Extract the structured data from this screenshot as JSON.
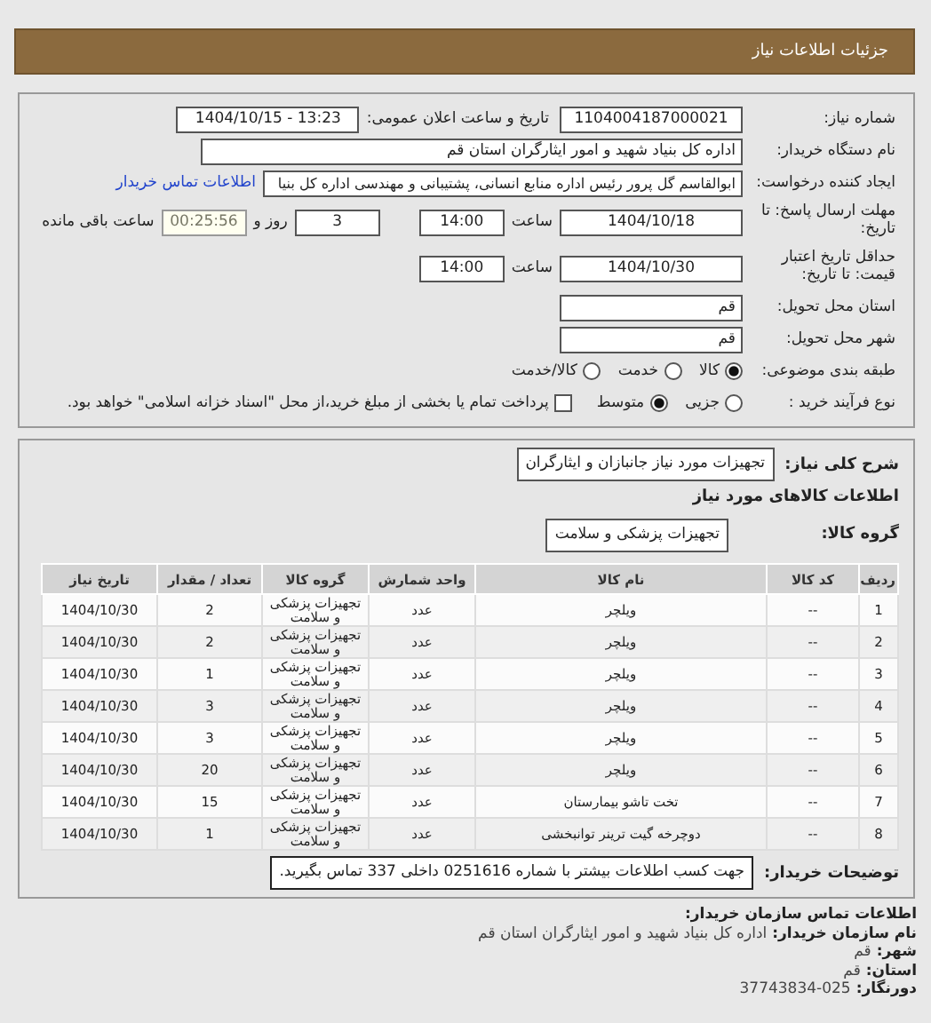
{
  "header": {
    "title": "جزئیات اطلاعات نیاز"
  },
  "need_number": {
    "label": "شماره نیاز:",
    "value": "1104004187000021"
  },
  "announce": {
    "label": "تاریخ و ساعت اعلان عمومی:",
    "value": "1404/10/15 - 13:23"
  },
  "buyer": {
    "label": "نام دستگاه خریدار:",
    "value": "اداره کل بنیاد شهید و امور ایثارگران استان قم"
  },
  "requester": {
    "label": "ایجاد کننده درخواست:",
    "value": "ابوالقاسم گل پرور رئیس اداره منابع انسانی، پشتیبانی و مهندسی اداره کل بنیا",
    "link": "اطلاعات تماس خریدار"
  },
  "deadline": {
    "label": "مهلت ارسال پاسخ: تا تاریخ:",
    "date": "1404/10/18",
    "time_label": "ساعت",
    "time": "14:00",
    "days": "3",
    "days_label": "روز و",
    "remaining": "00:25:56",
    "remaining_label": "ساعت باقی مانده"
  },
  "validity": {
    "label": "حداقل تاریخ اعتبار قیمت: تا تاریخ:",
    "date": "1404/10/30",
    "time_label": "ساعت",
    "time": "14:00"
  },
  "province": {
    "label": "استان محل تحویل:",
    "value": "قم"
  },
  "city": {
    "label": "شهر محل تحویل:",
    "value": "قم"
  },
  "category": {
    "label": "طبقه بندی موضوعی:",
    "options": [
      {
        "label": "کالا",
        "selected": true
      },
      {
        "label": "خدمت",
        "selected": false
      },
      {
        "label": "کالا/خدمت",
        "selected": false
      }
    ]
  },
  "process": {
    "label": "نوع فرآیند خرید :",
    "options": [
      {
        "label": "جزیی",
        "selected": false
      },
      {
        "label": "متوسط",
        "selected": true
      }
    ],
    "payment": {
      "checked": false,
      "text": "پرداخت تمام یا بخشی از مبلغ خرید،از محل \"اسناد خزانه اسلامی\" خواهد بود."
    }
  },
  "summary": {
    "label": "شرح کلی نیاز:",
    "value": "تجهیزات مورد نیاز جانبازان و ایثارگران"
  },
  "goods_title": "اطلاعات کالاهای مورد نیاز",
  "group": {
    "label": "گروه کالا:",
    "value": "تجهیزات پزشکی و سلامت"
  },
  "table": {
    "columns": [
      "ردیف",
      "کد کالا",
      "نام کالا",
      "واحد شمارش",
      "گروه کالا",
      "تعداد / مقدار",
      "تاریخ نیاز"
    ],
    "rows": [
      [
        "1",
        "--",
        "ویلچر",
        "عدد",
        "تجهیزات پزشکی و سلامت",
        "2",
        "1404/10/30"
      ],
      [
        "2",
        "--",
        "ویلچر",
        "عدد",
        "تجهیزات پزشکی و سلامت",
        "2",
        "1404/10/30"
      ],
      [
        "3",
        "--",
        "ویلچر",
        "عدد",
        "تجهیزات پزشکی و سلامت",
        "1",
        "1404/10/30"
      ],
      [
        "4",
        "--",
        "ویلچر",
        "عدد",
        "تجهیزات پزشکی و سلامت",
        "3",
        "1404/10/30"
      ],
      [
        "5",
        "--",
        "ویلچر",
        "عدد",
        "تجهیزات پزشکی و سلامت",
        "3",
        "1404/10/30"
      ],
      [
        "6",
        "--",
        "ویلچر",
        "عدد",
        "تجهیزات پزشکی و سلامت",
        "20",
        "1404/10/30"
      ],
      [
        "7",
        "--",
        "تخت تاشو بیمارستان",
        "عدد",
        "تجهیزات پزشکی و سلامت",
        "15",
        "1404/10/30"
      ],
      [
        "8",
        "--",
        "دوچرخه گیت ترینر توانبخشی",
        "عدد",
        "تجهیزات پزشکی و سلامت",
        "1",
        "1404/10/30"
      ]
    ]
  },
  "buyer_notes": {
    "label": "توضیحات خریدار:",
    "value": "جهت کسب اطلاعات بیشتر با شماره 0251616 داخلی 337 تماس بگیرید."
  },
  "contact": {
    "title": "اطلاعات تماس سازمان خریدار:",
    "lines": [
      {
        "label": "نام سازمان خریدار:",
        "value": "اداره کل بنیاد شهید و امور ایثارگران استان قم"
      },
      {
        "label": "شهر:",
        "value": "قم"
      },
      {
        "label": "استان:",
        "value": "قم"
      },
      {
        "label": "دورنگار:",
        "value": "37743834-025"
      }
    ]
  }
}
